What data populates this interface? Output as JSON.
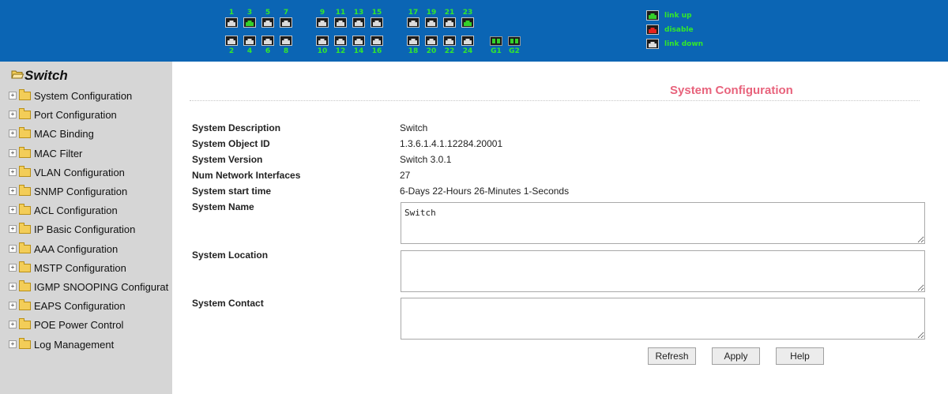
{
  "ports": {
    "top_numbers": [
      "1",
      "3",
      "5",
      "7",
      "9",
      "11",
      "13",
      "15",
      "17",
      "19",
      "21",
      "23"
    ],
    "bottom_numbers": [
      "2",
      "4",
      "6",
      "8",
      "10",
      "12",
      "14",
      "16",
      "18",
      "20",
      "22",
      "24"
    ],
    "gig_labels": [
      "G1",
      "G2"
    ],
    "top_status": [
      "down",
      "up",
      "down",
      "down",
      "down",
      "down",
      "down",
      "down",
      "down",
      "down",
      "down",
      "up"
    ],
    "bottom_status": [
      "down",
      "down",
      "down",
      "down",
      "down",
      "down",
      "down",
      "down",
      "down",
      "down",
      "down",
      "down"
    ]
  },
  "legend": [
    {
      "label": "link up",
      "status": "up"
    },
    {
      "label": "disable",
      "status": "disable"
    },
    {
      "label": "link down",
      "status": "down"
    }
  ],
  "sidebar": {
    "root": "Switch",
    "items": [
      "System Configuration",
      "Port Configuration",
      "MAC Binding",
      "MAC Filter",
      "VLAN Configuration",
      "SNMP Configuration",
      "ACL Configuration",
      "IP Basic Configuration",
      "AAA Configuration",
      "MSTP Configuration",
      "IGMP SNOOPING Configurat",
      "EAPS Configuration",
      "POE Power Control",
      "Log Management"
    ]
  },
  "main": {
    "title": "System Configuration",
    "fields": {
      "description": {
        "label": "System Description",
        "value": "Switch"
      },
      "object_id": {
        "label": "System Object ID",
        "value": "1.3.6.1.4.1.12284.20001"
      },
      "version": {
        "label": "System Version",
        "value": "Switch 3.0.1"
      },
      "interfaces": {
        "label": "Num Network Interfaces",
        "value": "27"
      },
      "start_time": {
        "label": "System start time",
        "value": "6-Days 22-Hours 26-Minutes 1-Seconds"
      },
      "name": {
        "label": "System Name",
        "value": "Switch"
      },
      "location": {
        "label": "System Location",
        "value": ""
      },
      "contact": {
        "label": "System Contact",
        "value": ""
      }
    },
    "buttons": {
      "refresh": "Refresh",
      "apply": "Apply",
      "help": "Help"
    }
  },
  "colors": {
    "header_bg": "#0b65b4",
    "port_label": "#33e82c",
    "link_up": "#34d12a",
    "disable": "#e8231e",
    "title": "#e8637c",
    "sidebar_bg": "#d6d6d6"
  }
}
